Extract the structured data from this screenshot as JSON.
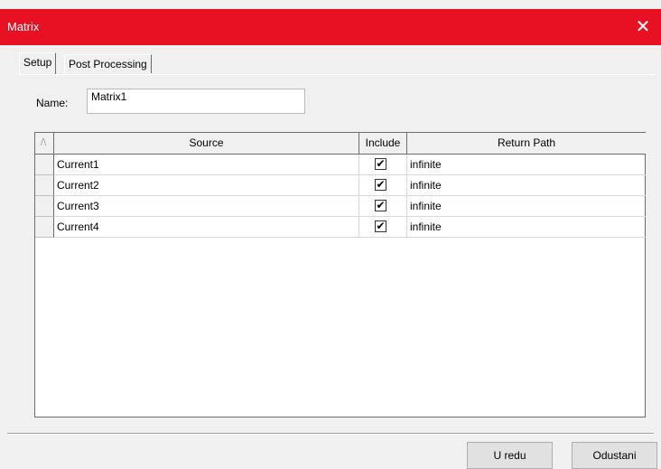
{
  "window": {
    "title": "Matrix",
    "close_glyph": "✕"
  },
  "tabs": [
    {
      "label": "Setup",
      "active": true
    },
    {
      "label": "Post Processing",
      "active": false
    }
  ],
  "name_field": {
    "label": "Name:",
    "value": "Matrix1"
  },
  "table": {
    "sort_indicator": "/\\",
    "columns": {
      "source": "Source",
      "include": "Include",
      "return_path": "Return Path"
    },
    "rows": [
      {
        "source": "Current1",
        "include": true,
        "return_path": "infinite"
      },
      {
        "source": "Current2",
        "include": true,
        "return_path": "infinite"
      },
      {
        "source": "Current3",
        "include": true,
        "return_path": "infinite"
      },
      {
        "source": "Current4",
        "include": true,
        "return_path": "infinite"
      }
    ]
  },
  "buttons": {
    "ok": "U redu",
    "cancel": "Odustani"
  },
  "colors": {
    "titlebar": "#e81123",
    "dialog_bg": "#f0f0f0"
  }
}
